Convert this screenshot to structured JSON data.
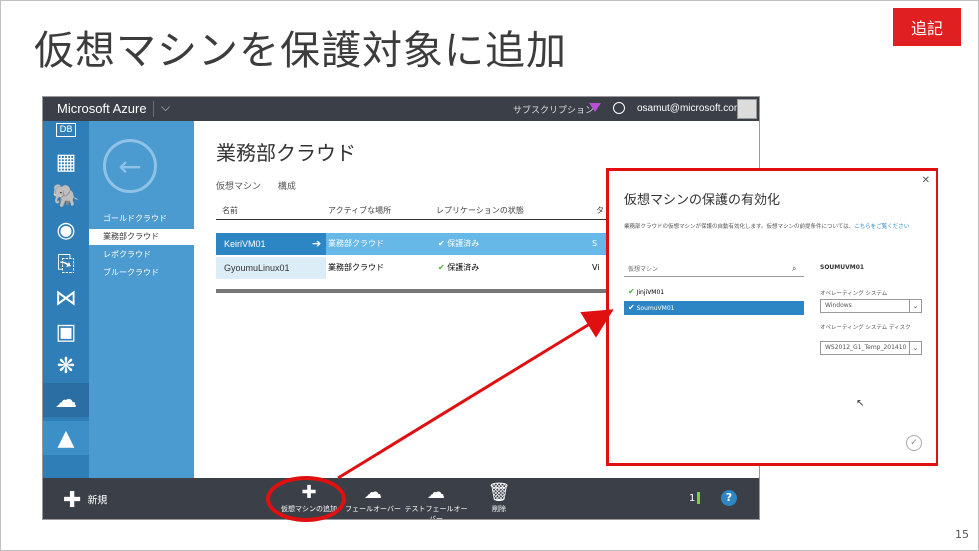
{
  "slide": {
    "title": "仮想マシンを保護対象に追加",
    "badge": "追記",
    "page_number": "15"
  },
  "portal": {
    "brand": "Microsoft Azure",
    "subscription_label": "サブスクリプション",
    "user_email": "osamut@microsoft.com",
    "iconbar": [
      "db-icon",
      "table-icon",
      "elephant-icon",
      "media-icon",
      "doc-export-icon",
      "visual-studio-icon",
      "backup-icon",
      "cloud-tree-icon",
      "cloud-icon",
      "mountain-icon"
    ],
    "nav": {
      "items": [
        "ゴールドクラウド",
        "業務部クラウド",
        "レポクラウド",
        "ブルークラウド"
      ],
      "selected_index": 1
    },
    "content": {
      "title": "業務部クラウド",
      "tabs": [
        "仮想マシン",
        "構成"
      ],
      "columns": [
        "名前",
        "アクティブな場所",
        "レプリケーションの状態",
        "タ"
      ],
      "rows": [
        {
          "name": "KeiriVM01",
          "location": "業務部クラウド",
          "status": "保護済み",
          "extra": "S"
        },
        {
          "name": "GyoumuLinux01",
          "location": "業務部クラウド",
          "status": "保護済み",
          "extra": "Vi"
        }
      ]
    },
    "commandbar": {
      "new_label": "新規",
      "commands": [
        {
          "label": "仮想マシンの追加",
          "icon": "plus-icon"
        },
        {
          "label": "フェールオーバー",
          "icon": "cloud-failover-icon"
        },
        {
          "label": "テストフェールオーバー",
          "icon": "cloud-test-icon"
        },
        {
          "label": "削除",
          "icon": "trash-icon"
        }
      ],
      "count": "1"
    }
  },
  "dialog": {
    "title": "仮想マシンの保護の有効化",
    "description": "業務部クラウドの仮想マシンが保護の自動有効化します。仮想マシンの前提条件については、",
    "link": "こちらをご覧ください",
    "search_placeholder": "仮想マシン",
    "vm_list": [
      "JinjiVM01",
      "SoumuVM01"
    ],
    "selected_vm_index": 1,
    "selected_vm_title": "SOUMUVM01",
    "os_label": "オペレーティング システム",
    "os_value": "Windows",
    "os_disk_label": "オペレーティング システム ディスク",
    "os_disk_value": "WS2012_G1_Temp_201410"
  }
}
